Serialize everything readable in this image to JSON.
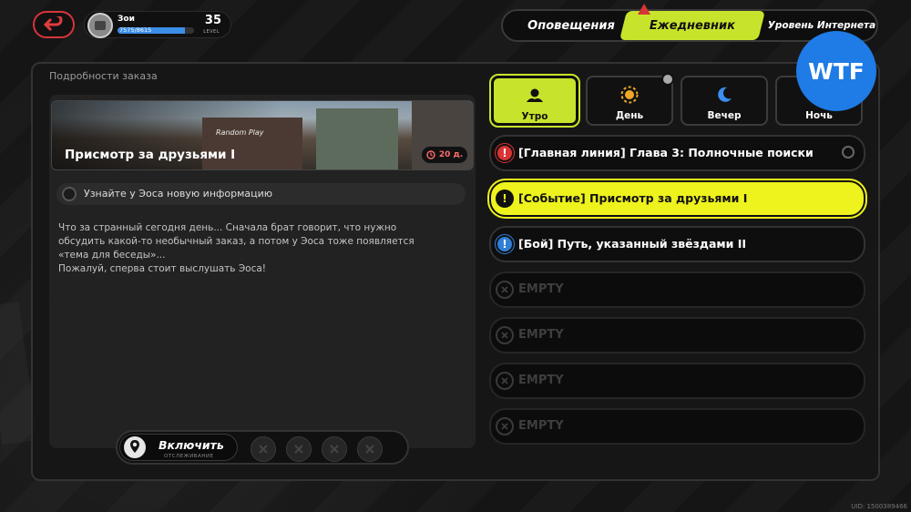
{
  "header": {
    "player_name": "Зои",
    "xp_text": "7575/8615",
    "xp_fraction": 0.879,
    "level": "35",
    "level_label": "LEVEL"
  },
  "top_tabs": [
    {
      "label": "Оповещения"
    },
    {
      "label": "Ежедневник"
    },
    {
      "label": "Уровень Интернета"
    }
  ],
  "badge": "WTF",
  "panel_title": "Подробности заказа",
  "order": {
    "banner_sign": "Random Play",
    "title": "Присмотр за друзьями I",
    "days": "20 д.",
    "objective": "Узнайте у Эоса новую информацию",
    "description": "Что за странный сегодня день... Сначала брат говорит, что нужно\nобсудить какой-то необычный заказ, а потом у Эоса тоже появляется\n«тема для беседы»...\nПожалуй, сперва стоит выслушать Эоса!"
  },
  "tracking": {
    "button_label": "Включить",
    "sub_label": "ОТСЛЕЖИВАНИЕ"
  },
  "time_tabs": [
    {
      "label": "Утро",
      "icon": "morning-icon"
    },
    {
      "label": "День",
      "icon": "sun-icon"
    },
    {
      "label": "Вечер",
      "icon": "moon-icon"
    },
    {
      "label": "Ночь",
      "icon": "night-icon"
    }
  ],
  "tasks": [
    {
      "text": "[Главная линия] Глава 3: Полночные поиски",
      "type": "main"
    },
    {
      "text": "[Событие] Присмотр за друзьями I",
      "type": "event"
    },
    {
      "text": "[Бой] Путь, указанный звёздами II",
      "type": "battle"
    },
    {
      "text": "EMPTY",
      "type": "empty"
    },
    {
      "text": "EMPTY",
      "type": "empty"
    },
    {
      "text": "EMPTY",
      "type": "empty"
    },
    {
      "text": "EMPTY",
      "type": "empty"
    }
  ],
  "uid": "UID: 1500389466",
  "colors": {
    "accent": "#c8e32b",
    "selected_task": "#eef21d",
    "main_quest": "#d83434",
    "battle_quest": "#2f7fd6",
    "brand_badge": "#1f7be6"
  }
}
